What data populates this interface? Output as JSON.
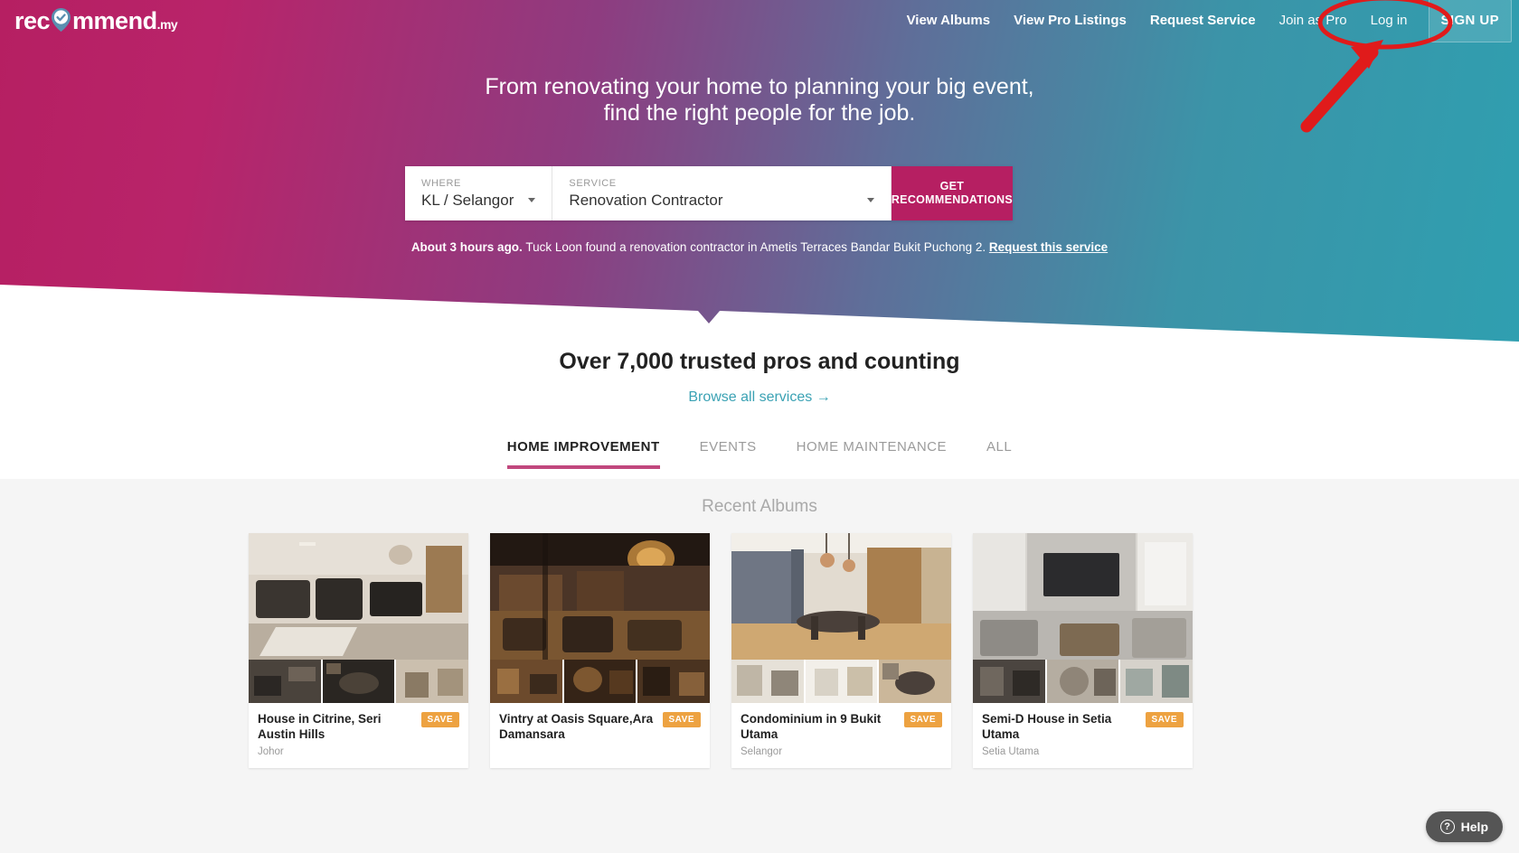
{
  "header": {
    "logo": {
      "text_before": "rec",
      "text_after": "mmend",
      "suffix": ".my",
      "icon": "location-pin-check-icon"
    },
    "nav": [
      {
        "label": "View Albums",
        "style": "bold"
      },
      {
        "label": "View Pro Listings",
        "style": "bold"
      },
      {
        "label": "Request Service",
        "style": "bold"
      },
      {
        "label": "Join as Pro",
        "style": "light"
      },
      {
        "label": "Log in",
        "style": "light"
      }
    ],
    "signup_label": "SIGN UP"
  },
  "hero": {
    "title_line1": "From renovating your home to planning your big event,",
    "title_line2": "find the right people for the job.",
    "search": {
      "where_label": "WHERE",
      "where_value": "KL / Selangor",
      "service_label": "SERVICE",
      "service_value": "Renovation Contractor",
      "button_line1": "GET",
      "button_line2": "RECOMMENDATIONS"
    },
    "ticker": {
      "time": "About 3 hours ago.",
      "text": " Tuck Loon found a renovation contractor in Ametis Terraces Bandar Bukit Puchong 2. ",
      "link": "Request this service"
    }
  },
  "trust": {
    "title": "Over 7,000 trusted pros and counting",
    "link": "Browse all services →"
  },
  "tabs": [
    {
      "label": "HOME IMPROVEMENT",
      "active": true
    },
    {
      "label": "EVENTS",
      "active": false
    },
    {
      "label": "HOME MAINTENANCE",
      "active": false
    },
    {
      "label": "ALL",
      "active": false
    }
  ],
  "albums": {
    "heading": "Recent Albums",
    "save_label": "SAVE",
    "items": [
      {
        "title": "House in Citrine, Seri Austin Hills",
        "location": "Johor"
      },
      {
        "title": "Vintry at Oasis Square,Ara Damansara",
        "location": ""
      },
      {
        "title": "Condominium in 9 Bukit Utama",
        "location": "Selangor"
      },
      {
        "title": "Semi-D House in Setia Utama",
        "location": "Setia Utama"
      }
    ]
  },
  "help": {
    "label": "Help",
    "icon": "question-mark-circle-icon"
  },
  "annotation": {
    "type": "red-ellipse-and-arrow",
    "color": "#e01b1b",
    "target": "Log in"
  },
  "colors": {
    "brand_pink": "#b61f62",
    "brand_teal": "#2f9fb0",
    "tab_underline": "#c1487e",
    "link_teal": "#3ba2b4",
    "save_orange": "#eda241",
    "annotation_red": "#e01b1b"
  }
}
